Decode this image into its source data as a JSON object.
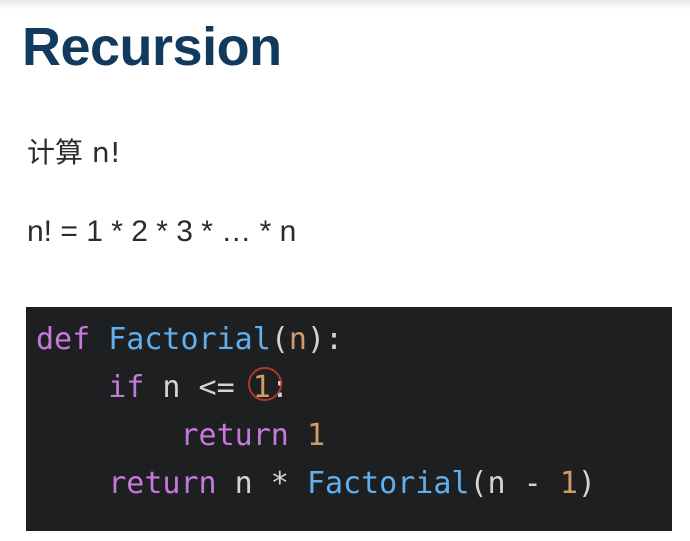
{
  "slide": {
    "title": "Recursion",
    "line1": "计算 n!",
    "line2": "n! = 1 * 2 * 3 * … * n"
  },
  "code": {
    "l1": {
      "def": "def",
      "name": "Factorial",
      "open": "(",
      "param": "n",
      "close": "):"
    },
    "l2": {
      "indent": "    ",
      "kw": "if",
      "rest": " n <= ",
      "num": "1",
      "end": ":"
    },
    "l3": {
      "indent": "        ",
      "kw": "return",
      "sp": " ",
      "num": "1"
    },
    "l4": {
      "indent": "    ",
      "kw": "return",
      "mid": " n * ",
      "name": "Factorial",
      "open": "(n - ",
      "num": "1",
      "close": ")"
    }
  },
  "colors": {
    "title": "#123a5e",
    "code_bg": "#1d1f21",
    "keyword": "#c678dd",
    "function": "#61afef",
    "number": "#d19a66"
  }
}
